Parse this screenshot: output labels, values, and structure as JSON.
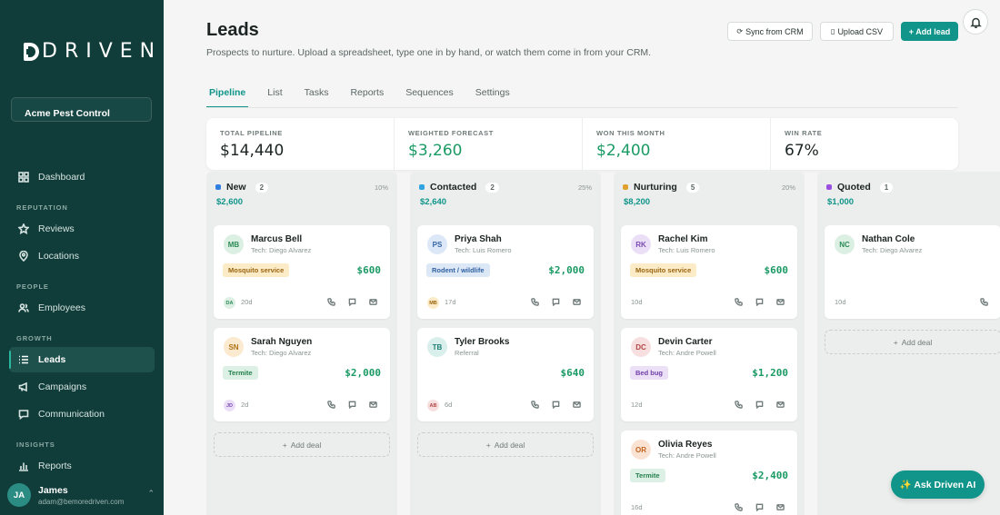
{
  "brand": {
    "name": "DRIVEN"
  },
  "org": "Acme Pest Control",
  "nav": {
    "dashboard": "Dashboard",
    "sections": {
      "reputation": "REPUTATION",
      "people": "PEOPLE",
      "growth": "GROWTH",
      "insights": "INSIGHTS"
    },
    "reviews": "Reviews",
    "locations": "Locations",
    "employees": "Employees",
    "leads": "Leads",
    "campaigns": "Campaigns",
    "communication": "Communication",
    "reports": "Reports"
  },
  "user": {
    "initials": "JA",
    "name": "James",
    "email": "adam@bemoredriven.com"
  },
  "header": {
    "title": "Leads",
    "subtitle": "Prospects to nurture. Upload a spreadsheet, type one in by hand, or watch them come in from your CRM.",
    "sync": "Sync from CRM",
    "upload": "Upload CSV",
    "add": "+ Add lead"
  },
  "tabs": [
    "Pipeline",
    "List",
    "Tasks",
    "Reports",
    "Sequences",
    "Settings"
  ],
  "active_tab": "Pipeline",
  "kpis": [
    {
      "label": "TOTAL PIPELINE",
      "value": "$14,440",
      "green": false
    },
    {
      "label": "WEIGHTED FORECAST",
      "value": "$3,260",
      "green": true
    },
    {
      "label": "WON THIS MONTH",
      "value": "$2,400",
      "green": true
    },
    {
      "label": "WIN RATE",
      "value": "67%",
      "green": false
    }
  ],
  "add_deal_label": "Add deal",
  "columns": [
    {
      "title": "New",
      "count": "2",
      "pct": "10%",
      "total": "$2,600",
      "color": "#2f7ee0",
      "cards": [
        {
          "initials": "MB",
          "name": "Marcus Bell",
          "sub": "Tech: Diego Alvarez",
          "tag": "Mosquito service",
          "tag_type": "amber",
          "amount": "$600",
          "owner": "DA",
          "age": "20d",
          "avatar": "green"
        },
        {
          "initials": "SN",
          "name": "Sarah Nguyen",
          "sub": "Tech: Diego Alvarez",
          "tag": "Termite",
          "tag_type": "green",
          "amount": "$2,000",
          "owner": "JD",
          "age": "2d",
          "avatar": "amber"
        }
      ]
    },
    {
      "title": "Contacted",
      "count": "2",
      "pct": "25%",
      "total": "$2,640",
      "color": "#2fa4e0",
      "cards": [
        {
          "initials": "PS",
          "name": "Priya Shah",
          "sub": "Tech: Luis Romero",
          "tag": "Rodent / wildlife",
          "tag_type": "blue",
          "amount": "$2,000",
          "owner": "MB",
          "age": "17d",
          "avatar": "blue"
        },
        {
          "initials": "TB",
          "name": "Tyler Brooks",
          "sub": "Referral",
          "tag": "",
          "tag_type": "",
          "amount": "$640",
          "owner": "AB",
          "age": "6d",
          "avatar": "teal"
        }
      ]
    },
    {
      "title": "Nurturing",
      "count": "5",
      "pct": "20%",
      "total": "$8,200",
      "color": "#e0a12f",
      "cards": [
        {
          "initials": "RK",
          "name": "Rachel Kim",
          "sub": "Tech: Luis Romero",
          "tag": "Mosquito service",
          "tag_type": "amber",
          "amount": "$600",
          "owner": "",
          "age": "10d",
          "avatar": "purple"
        },
        {
          "initials": "DC",
          "name": "Devin Carter",
          "sub": "Tech: Andre Powell",
          "tag": "Bed bug",
          "tag_type": "purple",
          "amount": "$1,200",
          "owner": "",
          "age": "12d",
          "avatar": "red"
        },
        {
          "initials": "OR",
          "name": "Olivia Reyes",
          "sub": "Tech: Andre Powell",
          "tag": "Termite",
          "tag_type": "green",
          "amount": "$2,400",
          "owner": "",
          "age": "16d",
          "avatar": "orange"
        }
      ]
    },
    {
      "title": "Quoted",
      "count": "1",
      "pct": "",
      "total": "$1,000",
      "color": "#9a4fe0",
      "cards": [
        {
          "initials": "NC",
          "name": "Nathan Cole",
          "sub": "Tech: Diego Alvarez",
          "tag": "",
          "tag_type": "",
          "amount": "",
          "owner": "",
          "age": "10d",
          "avatar": "green"
        }
      ]
    }
  ],
  "ask_ai": "✨ Ask Driven AI"
}
